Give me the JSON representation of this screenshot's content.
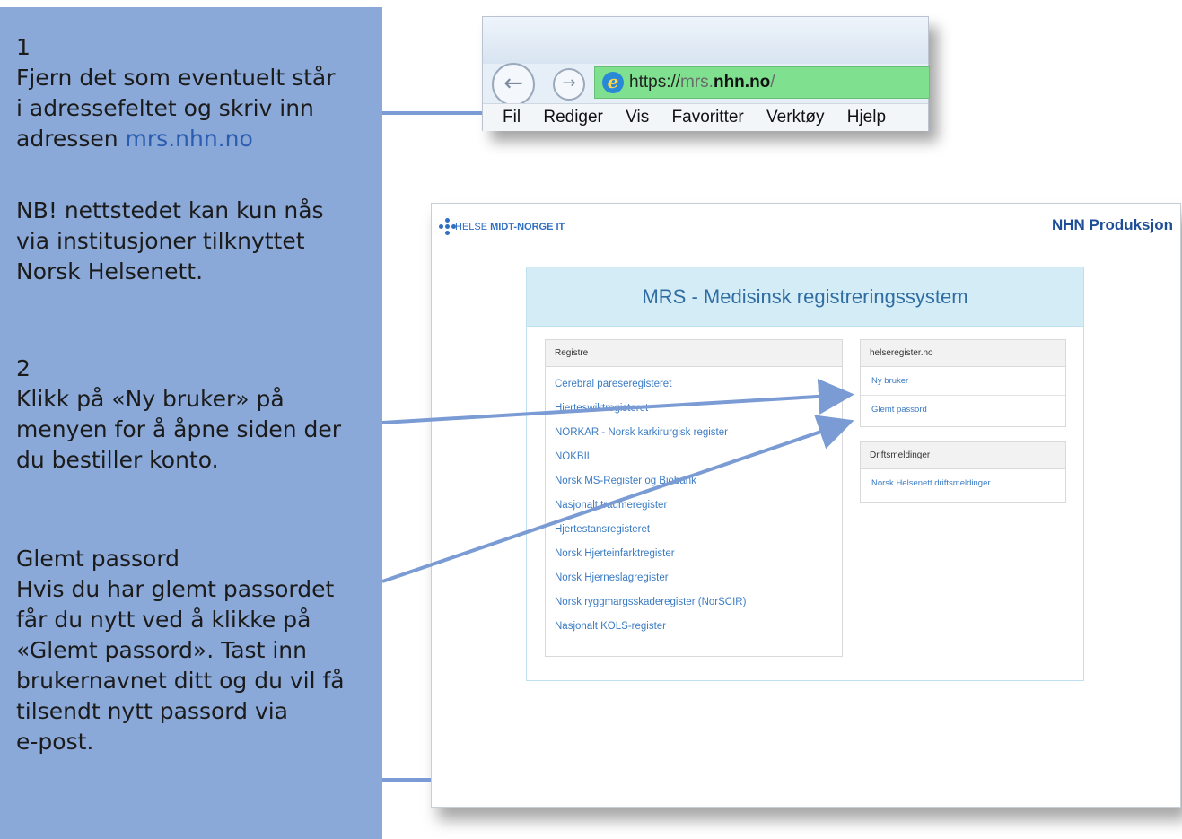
{
  "instructions": {
    "step1_number": "1",
    "step1_line1": "Fjern det som eventuelt står",
    "step1_line2": "i adressefeltet og skriv inn",
    "step1_line3_prefix": "adressen ",
    "step1_line3_link": "mrs.nhn.no",
    "note_line1": "NB! nettstedet kan kun nås",
    "note_line2": "via institusjoner tilknyttet",
    "note_line3": "Norsk Helsenett.",
    "step2_number": "2",
    "step2_line1": "Klikk på «Ny bruker» på",
    "step2_line2": "menyen for å åpne siden der",
    "step2_line3": "du bestiller konto.",
    "forgot_title": "Glemt passord",
    "forgot_line1": "Hvis du har glemt passordet",
    "forgot_line2": "får du nytt ved å klikke på",
    "forgot_line3": "«Glemt passord». Tast inn",
    "forgot_line4": "brukernavnet ditt og du vil få",
    "forgot_line5": "tilsendt nytt passord via",
    "forgot_line6": "e-post."
  },
  "browser": {
    "back_icon": "back-arrow-icon",
    "forward_icon": "forward-arrow-icon",
    "url_protocol": "https://",
    "url_host_light": "mrs.",
    "url_host_strong": "nhn.no",
    "url_trailing": "/",
    "menu": [
      "Fil",
      "Rediger",
      "Vis",
      "Favoritter",
      "Verktøy",
      "Hjelp"
    ]
  },
  "site": {
    "logo_text_light": "HELSE ",
    "logo_text_bold": "MIDT-NORGE IT",
    "environment": "NHN Produksjon",
    "app_title": "MRS - Medisinsk registreringssystem",
    "registers_heading": "Registre",
    "registers": [
      "Cerebral pareseregisteret",
      "Hjerteswiktregisteret",
      "NORKAR - Norsk karkirurgisk register",
      "NOKBIL",
      "Norsk MS-Register og Biobank",
      "Nasjonalt traumeregister",
      "Hjertestansregisteret",
      "Norsk Hjerteinfarktregister",
      "Norsk Hjerneslagregister",
      "Norsk ryggmargsskaderegister (NorSCIR)",
      "Nasjonalt KOLS-register"
    ],
    "helseregister_heading": "helseregister.no",
    "helseregister_links": [
      "Ny bruker",
      "Glemt passord"
    ],
    "driftsmeldinger_heading": "Driftsmeldinger",
    "driftsmeldinger_links": [
      "Norsk Helsenett driftsmeldinger"
    ]
  },
  "colors": {
    "panel_bg": "#8aa8d8",
    "connector": "#7a9bd3",
    "address_bar": "#7fe08f",
    "link": "#3b7cc4",
    "heading_band": "#d3ecf6"
  }
}
